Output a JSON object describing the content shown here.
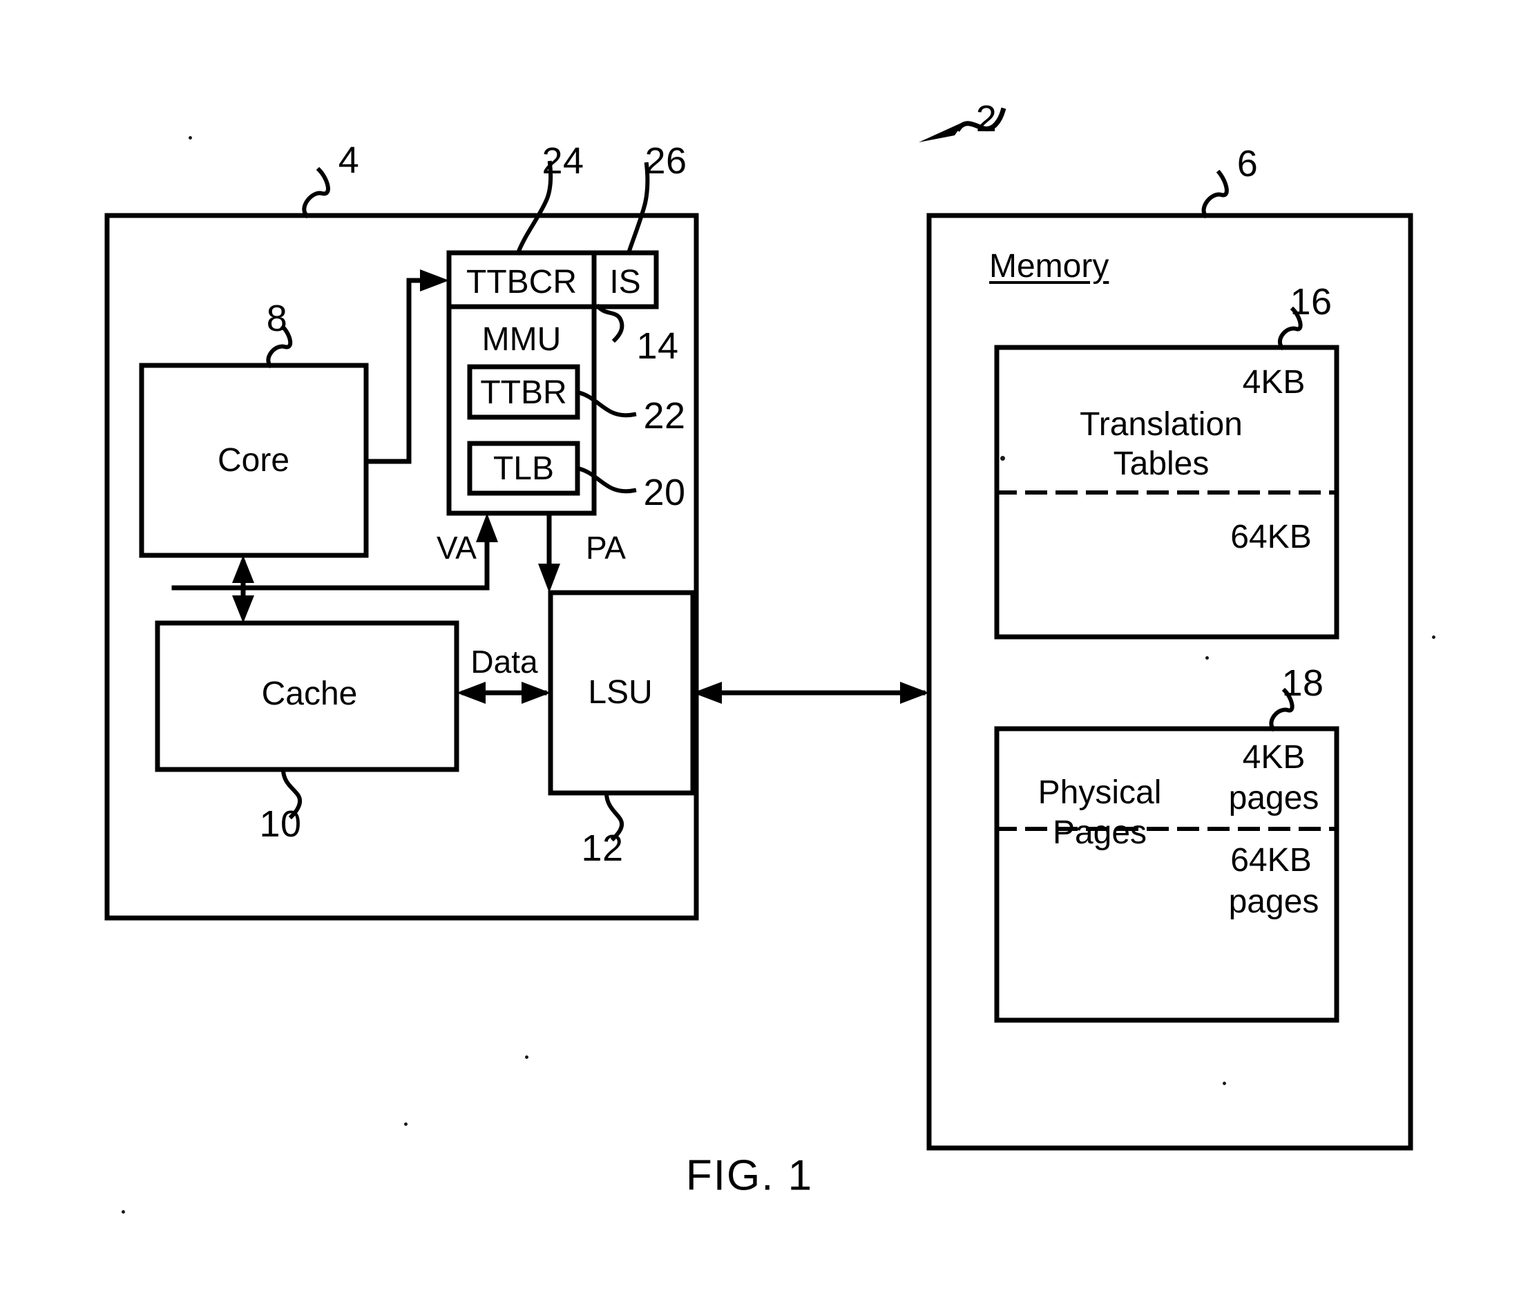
{
  "figure": {
    "caption": "FIG. 1",
    "system_ref": "2"
  },
  "processor": {
    "ref": "4",
    "blocks": {
      "core": {
        "label": "Core",
        "ref": "8"
      },
      "cache": {
        "label": "Cache",
        "ref": "10"
      },
      "lsu": {
        "label": "LSU",
        "ref": "12"
      },
      "mmu": {
        "label": "MMU",
        "ref": "14",
        "ttbcr": {
          "label": "TTBCR",
          "ref": "24"
        },
        "is": {
          "label": "IS",
          "ref": "26"
        },
        "ttbr": {
          "label": "TTBR",
          "ref": "22"
        },
        "tlb": {
          "label": "TLB",
          "ref": "20"
        }
      }
    },
    "signals": {
      "va": "VA",
      "pa": "PA",
      "data": "Data"
    }
  },
  "memory": {
    "ref": "6",
    "title": "Memory",
    "translation_tables": {
      "ref": "16",
      "label_line1": "Translation",
      "label_line2": "Tables",
      "upper_size": "4KB",
      "lower_size": "64KB"
    },
    "physical_pages": {
      "ref": "18",
      "label_line1": "Physical",
      "label_line2": "Pages",
      "upper_size_line1": "4KB",
      "upper_size_line2": "pages",
      "lower_size_line1": "64KB",
      "lower_size_line2": "pages"
    }
  }
}
